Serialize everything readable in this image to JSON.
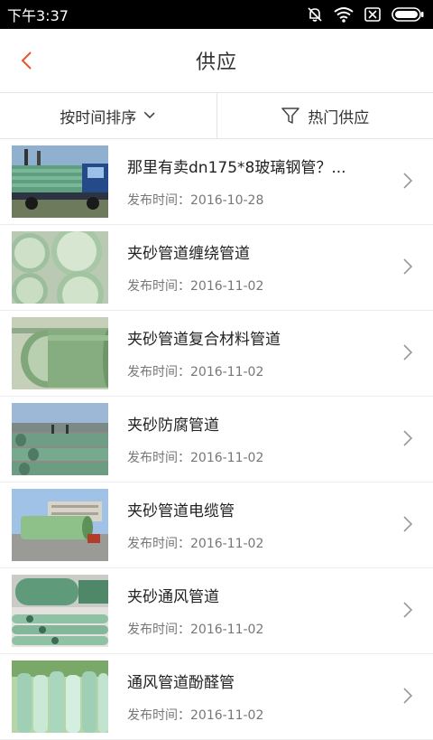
{
  "status": {
    "time": "下午3:37"
  },
  "header": {
    "title": "供应"
  },
  "filters": {
    "sort_label": "按时间排序",
    "hot_label": "热门供应"
  },
  "items": [
    {
      "title": "那里有卖dn175*8玻璃钢管？...",
      "date_prefix": "发布时间：",
      "date": "2016-10-28",
      "image": "truck-pipes"
    },
    {
      "title": "夹砂管道缠绕管道",
      "date_prefix": "发布时间：",
      "date": "2016-11-02",
      "image": "pipe-ends"
    },
    {
      "title": "夹砂管道复合材料管道",
      "date_prefix": "发布时间：",
      "date": "2016-11-02",
      "image": "large-pipe"
    },
    {
      "title": "夹砂防腐管道",
      "date_prefix": "发布时间：",
      "date": "2016-11-02",
      "image": "pipe-yard"
    },
    {
      "title": "夹砂管道电缆管",
      "date_prefix": "发布时间：",
      "date": "2016-11-02",
      "image": "pipe-building"
    },
    {
      "title": "夹砂通风管道",
      "date_prefix": "发布时间：",
      "date": "2016-11-02",
      "image": "vent-pipes"
    },
    {
      "title": "通风管道酚醛管",
      "date_prefix": "发布时间：",
      "date": "2016-11-02",
      "image": "pipe-stack"
    }
  ]
}
